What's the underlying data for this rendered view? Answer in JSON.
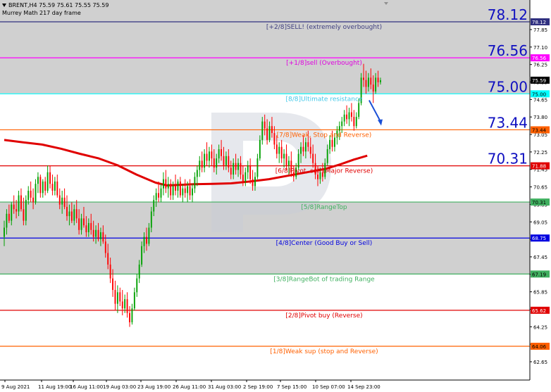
{
  "header": {
    "symbol_line": "BRENT,H4  75.59 75.61 75.55 75.59",
    "indicator_line": "Murrey Math 217 day frame"
  },
  "colors": {
    "bull": "#00a000",
    "bear": "#ff0000",
    "ma": "#e00000",
    "arrow": "#1a4fd6",
    "big_label": "#1010c0",
    "zone_fill": "#d0d0d0"
  },
  "chart_data": {
    "type": "candlestick",
    "symbol": "BRENT",
    "timeframe": "H4",
    "quote": {
      "open": 75.59,
      "high": 75.61,
      "low": 75.55,
      "close": 75.59
    },
    "indicator": "Murrey Math 217 day frame",
    "ylim": [
      62.82,
      79.12
    ],
    "y_ticks": [
      "77.85",
      "77.10",
      "76.25",
      "75.35",
      "74.65",
      "73.80",
      "73.05",
      "72.25",
      "71.45",
      "70.65",
      "69.85",
      "69.05",
      "68.25",
      "67.45",
      "66.66",
      "65.85",
      "65.05",
      "64.25",
      "63.45",
      "62.65"
    ],
    "x_ticks": [
      "9 Aug 2021",
      "11 Aug 19:00",
      "16 Aug 11:00",
      "19 Aug 03:00",
      "23 Aug 19:00",
      "26 Aug 11:00",
      "31 Aug 03:00",
      "2 Sep 19:00",
      "7 Sep 15:00",
      "10 Sep 07:00",
      "14 Sep 23:00"
    ],
    "murrey_levels": [
      {
        "value": 78.12,
        "label": "[+2/8]SELL! (extremely overbought)",
        "tag": "78.12",
        "big": "78.12",
        "color": "#303080",
        "label_color": "#404080"
      },
      {
        "value": 76.56,
        "label": "[+1/8]sell (Overbought)",
        "tag": "76.56",
        "big": "76.56",
        "color": "#ff00ff",
        "label_color": "#e000e0"
      },
      {
        "value": 75.0,
        "label": "[8/8]Ultimate resistance",
        "tag": "75.00",
        "big": "75.00",
        "color": "#00ffff",
        "label_color": "#40c8e8"
      },
      {
        "value": 73.44,
        "label": "[7/8]Weak, Stop and Reverse)",
        "tag": "73.44",
        "big": "73.44",
        "color": "#ff6000",
        "label_color": "#ff6000"
      },
      {
        "value": 71.88,
        "label": "[6/8]Pivot, sell (Major Reverse)",
        "tag": "71.88",
        "big": "70.31",
        "color": "#e00000",
        "label_color": "#e00000"
      },
      {
        "value": 70.31,
        "label": "[5/8]RangeTop",
        "tag": "70.31",
        "big": "",
        "color": "#40b060",
        "label_color": "#40b060"
      },
      {
        "value": 68.75,
        "label": "[4/8]Center (Good Buy or Sell)",
        "tag": "68.75",
        "big": "",
        "color": "#0000e0",
        "label_color": "#0000e0"
      },
      {
        "value": 67.19,
        "label": "[3/8]RangeBot of trading Range",
        "tag": "67.19",
        "big": "",
        "color": "#40b060",
        "label_color": "#40b060"
      },
      {
        "value": 65.62,
        "label": "[2/8]Pivot buy (Reverse)",
        "tag": "65.62",
        "big": "",
        "color": "#e00000",
        "label_color": "#e00000"
      },
      {
        "value": 64.06,
        "label": "[1/8]Weak sup (stop and Reverse)",
        "tag": "64.06",
        "big": "",
        "color": "#ff6000",
        "label_color": "#ff6000"
      }
    ],
    "current_price_tag": "75.59",
    "shaded_zones": [
      [
        75.0,
        79.12
      ],
      [
        67.19,
        70.31
      ]
    ],
    "moving_average": [
      [
        0,
        73.0
      ],
      [
        10,
        72.9
      ],
      [
        20,
        72.8
      ],
      [
        30,
        72.62
      ],
      [
        40,
        72.4
      ],
      [
        50,
        72.2
      ],
      [
        60,
        71.9
      ],
      [
        70,
        71.5
      ],
      [
        80,
        71.15
      ],
      [
        86,
        71.03
      ],
      [
        92,
        71.05
      ],
      [
        100,
        71.08
      ],
      [
        110,
        71.1
      ],
      [
        120,
        71.12
      ],
      [
        130,
        71.2
      ],
      [
        140,
        71.3
      ],
      [
        150,
        71.45
      ],
      [
        160,
        71.6
      ],
      [
        170,
        71.75
      ],
      [
        178,
        71.95
      ],
      [
        185,
        72.15
      ],
      [
        192,
        72.32
      ]
    ],
    "forecast_arrow": {
      "from": [
        193,
        74.72
      ],
      "to": [
        199,
        73.62
      ]
    },
    "candles": [
      [
        68.8,
        69.5,
        68.4,
        69.2
      ],
      [
        69.2,
        70.0,
        68.9,
        69.8
      ],
      [
        69.8,
        70.2,
        69.4,
        69.5
      ],
      [
        69.5,
        70.3,
        69.3,
        70.2
      ],
      [
        70.2,
        70.6,
        69.8,
        70.0
      ],
      [
        70.0,
        70.4,
        69.6,
        69.9
      ],
      [
        69.9,
        70.8,
        69.7,
        70.6
      ],
      [
        70.6,
        70.9,
        69.9,
        70.0
      ],
      [
        70.0,
        70.5,
        69.3,
        69.5
      ],
      [
        69.5,
        70.6,
        69.3,
        70.4
      ],
      [
        70.4,
        71.0,
        70.2,
        70.8
      ],
      [
        70.8,
        71.2,
        70.3,
        70.5
      ],
      [
        70.5,
        70.9,
        70.0,
        70.3
      ],
      [
        70.3,
        71.3,
        70.2,
        71.1
      ],
      [
        71.1,
        71.6,
        70.7,
        71.4
      ],
      [
        71.4,
        71.5,
        70.5,
        70.7
      ],
      [
        70.7,
        71.3,
        70.5,
        71.2
      ],
      [
        71.2,
        71.4,
        70.6,
        70.8
      ],
      [
        70.8,
        71.9,
        70.7,
        71.6
      ],
      [
        71.6,
        71.9,
        70.9,
        71.1
      ],
      [
        71.1,
        71.5,
        70.6,
        70.8
      ],
      [
        70.8,
        71.4,
        70.6,
        71.2
      ],
      [
        71.2,
        71.5,
        70.5,
        70.6
      ],
      [
        70.6,
        70.9,
        70.0,
        70.2
      ],
      [
        70.2,
        70.8,
        69.8,
        70.5
      ],
      [
        70.5,
        70.9,
        70.0,
        70.1
      ],
      [
        70.1,
        70.6,
        69.5,
        69.7
      ],
      [
        69.7,
        70.2,
        69.3,
        69.9
      ],
      [
        69.9,
        70.3,
        69.4,
        69.5
      ],
      [
        69.5,
        70.2,
        69.3,
        70.0
      ],
      [
        70.0,
        70.4,
        69.4,
        69.6
      ],
      [
        69.6,
        70.0,
        68.9,
        69.1
      ],
      [
        69.1,
        69.8,
        68.9,
        69.6
      ],
      [
        69.6,
        70.1,
        69.2,
        69.3
      ],
      [
        69.3,
        69.7,
        68.8,
        69.0
      ],
      [
        69.0,
        69.6,
        68.8,
        69.4
      ],
      [
        69.4,
        69.8,
        68.9,
        69.1
      ],
      [
        69.1,
        69.5,
        68.6,
        68.8
      ],
      [
        68.8,
        69.3,
        68.5,
        69.1
      ],
      [
        69.1,
        69.4,
        68.6,
        68.7
      ],
      [
        68.7,
        69.2,
        68.4,
        69.0
      ],
      [
        69.0,
        69.3,
        68.5,
        68.6
      ],
      [
        68.6,
        68.9,
        67.9,
        68.1
      ],
      [
        68.1,
        68.5,
        67.4,
        67.6
      ],
      [
        67.6,
        67.9,
        66.8,
        67.0
      ],
      [
        67.0,
        67.4,
        66.2,
        66.5
      ],
      [
        66.5,
        66.9,
        65.6,
        65.9
      ],
      [
        65.9,
        66.7,
        65.5,
        66.4
      ],
      [
        66.4,
        66.6,
        65.8,
        66.0
      ],
      [
        66.0,
        66.5,
        65.4,
        65.7
      ],
      [
        65.7,
        66.3,
        65.5,
        66.1
      ],
      [
        66.1,
        66.4,
        65.3,
        65.5
      ],
      [
        65.5,
        65.8,
        64.9,
        65.1
      ],
      [
        65.1,
        65.9,
        65.0,
        65.7
      ],
      [
        65.7,
        66.6,
        65.6,
        66.4
      ],
      [
        66.4,
        67.2,
        66.2,
        67.0
      ],
      [
        67.0,
        67.8,
        66.8,
        67.6
      ],
      [
        67.6,
        68.6,
        67.5,
        68.4
      ],
      [
        68.4,
        69.0,
        68.1,
        68.8
      ],
      [
        68.8,
        69.2,
        68.2,
        68.5
      ],
      [
        68.5,
        69.4,
        68.4,
        69.2
      ],
      [
        69.2,
        70.1,
        69.0,
        69.9
      ],
      [
        69.9,
        70.6,
        69.7,
        70.4
      ],
      [
        70.4,
        70.9,
        70.1,
        70.7
      ],
      [
        70.7,
        71.2,
        70.3,
        70.5
      ],
      [
        70.5,
        71.1,
        70.3,
        70.9
      ],
      [
        70.9,
        71.6,
        70.6,
        71.3
      ],
      [
        71.3,
        71.7,
        70.7,
        70.9
      ],
      [
        70.9,
        71.4,
        70.5,
        71.1
      ],
      [
        71.1,
        71.3,
        70.4,
        70.6
      ],
      [
        70.6,
        71.2,
        70.4,
        71.0
      ],
      [
        71.0,
        71.5,
        70.6,
        70.8
      ],
      [
        70.8,
        71.3,
        70.5,
        71.2
      ],
      [
        71.2,
        71.4,
        70.5,
        70.6
      ],
      [
        70.6,
        71.1,
        70.3,
        70.9
      ],
      [
        70.9,
        71.3,
        70.5,
        70.7
      ],
      [
        70.7,
        71.2,
        70.3,
        71.0
      ],
      [
        71.0,
        71.3,
        70.4,
        70.6
      ],
      [
        70.6,
        71.1,
        70.3,
        70.9
      ],
      [
        70.9,
        71.6,
        70.7,
        71.4
      ],
      [
        71.4,
        71.9,
        71.0,
        71.7
      ],
      [
        71.7,
        72.3,
        71.4,
        72.1
      ],
      [
        72.1,
        72.5,
        71.6,
        71.8
      ],
      [
        71.8,
        72.6,
        71.6,
        72.4
      ],
      [
        72.4,
        72.9,
        71.9,
        72.1
      ],
      [
        72.1,
        72.7,
        71.8,
        72.5
      ],
      [
        72.5,
        72.8,
        71.9,
        72.2
      ],
      [
        72.2,
        72.6,
        71.6,
        71.8
      ],
      [
        71.8,
        72.4,
        71.5,
        72.2
      ],
      [
        72.2,
        72.8,
        72.0,
        72.6
      ],
      [
        72.6,
        73.0,
        72.1,
        72.3
      ],
      [
        72.3,
        72.7,
        71.7,
        71.9
      ],
      [
        71.9,
        72.5,
        71.7,
        72.3
      ],
      [
        72.3,
        72.6,
        71.6,
        71.8
      ],
      [
        71.8,
        72.1,
        71.3,
        71.5
      ],
      [
        71.5,
        72.2,
        71.3,
        72.0
      ],
      [
        72.0,
        72.4,
        71.5,
        71.7
      ],
      [
        71.7,
        72.2,
        71.4,
        72.0
      ],
      [
        72.0,
        72.3,
        71.3,
        71.5
      ],
      [
        71.5,
        71.9,
        71.0,
        71.2
      ],
      [
        71.2,
        71.8,
        71.0,
        71.6
      ],
      [
        71.6,
        72.1,
        71.3,
        71.9
      ],
      [
        71.9,
        72.2,
        71.1,
        71.3
      ],
      [
        71.3,
        71.7,
        70.8,
        71.0
      ],
      [
        71.0,
        71.6,
        70.8,
        71.4
      ],
      [
        71.4,
        72.4,
        71.3,
        72.2
      ],
      [
        72.2,
        73.2,
        72.1,
        73.0
      ],
      [
        73.0,
        74.0,
        72.8,
        73.8
      ],
      [
        73.8,
        74.1,
        73.2,
        73.5
      ],
      [
        73.5,
        73.9,
        72.8,
        73.0
      ],
      [
        73.0,
        73.8,
        72.9,
        73.6
      ],
      [
        73.6,
        74.0,
        73.1,
        73.3
      ],
      [
        73.3,
        73.6,
        72.6,
        72.8
      ],
      [
        72.8,
        73.2,
        72.2,
        72.4
      ],
      [
        72.4,
        72.9,
        72.0,
        72.7
      ],
      [
        72.7,
        73.0,
        72.0,
        72.2
      ],
      [
        72.2,
        72.6,
        71.8,
        72.4
      ],
      [
        72.4,
        72.8,
        71.7,
        71.9
      ],
      [
        71.9,
        72.3,
        71.5,
        72.1
      ],
      [
        72.1,
        72.5,
        71.4,
        71.6
      ],
      [
        71.6,
        71.9,
        71.2,
        71.4
      ],
      [
        71.4,
        72.0,
        71.3,
        71.8
      ],
      [
        71.8,
        72.6,
        71.7,
        72.4
      ],
      [
        72.4,
        72.9,
        72.0,
        72.7
      ],
      [
        72.7,
        73.2,
        72.3,
        72.5
      ],
      [
        72.5,
        73.1,
        72.2,
        72.9
      ],
      [
        72.9,
        73.4,
        72.5,
        72.7
      ],
      [
        72.7,
        73.1,
        72.2,
        72.4
      ],
      [
        72.4,
        72.8,
        71.8,
        72.0
      ],
      [
        72.0,
        72.4,
        71.3,
        71.5
      ],
      [
        71.5,
        71.9,
        71.0,
        71.3
      ],
      [
        71.3,
        71.8,
        71.1,
        71.6
      ],
      [
        71.6,
        72.0,
        71.2,
        71.4
      ],
      [
        71.4,
        72.2,
        71.3,
        72.0
      ],
      [
        72.0,
        72.8,
        71.9,
        72.6
      ],
      [
        72.6,
        73.2,
        72.4,
        73.0
      ],
      [
        73.0,
        73.4,
        72.5,
        72.7
      ],
      [
        72.7,
        73.3,
        72.5,
        73.1
      ],
      [
        73.1,
        73.6,
        72.8,
        73.4
      ],
      [
        73.4,
        73.8,
        73.0,
        73.6
      ],
      [
        73.6,
        74.0,
        73.3,
        73.8
      ],
      [
        73.8,
        74.3,
        73.6,
        74.1
      ],
      [
        74.1,
        74.5,
        73.7,
        73.9
      ],
      [
        73.9,
        74.4,
        73.6,
        74.2
      ],
      [
        74.2,
        74.6,
        73.8,
        74.0
      ],
      [
        74.0,
        74.3,
        73.4,
        73.6
      ],
      [
        73.6,
        74.2,
        73.5,
        74.0
      ],
      [
        74.0,
        74.8,
        73.9,
        74.6
      ],
      [
        74.6,
        75.9,
        74.5,
        75.7
      ],
      [
        75.7,
        76.3,
        75.3,
        75.6
      ],
      [
        75.6,
        76.0,
        75.0,
        75.3
      ],
      [
        75.3,
        75.9,
        75.1,
        75.7
      ],
      [
        75.7,
        76.1,
        75.2,
        75.4
      ],
      [
        75.4,
        75.8,
        74.6,
        75.1
      ],
      [
        75.1,
        75.9,
        75.0,
        75.7
      ],
      [
        75.7,
        76.0,
        75.3,
        75.5
      ],
      [
        75.5,
        75.7,
        75.4,
        75.59
      ]
    ]
  }
}
